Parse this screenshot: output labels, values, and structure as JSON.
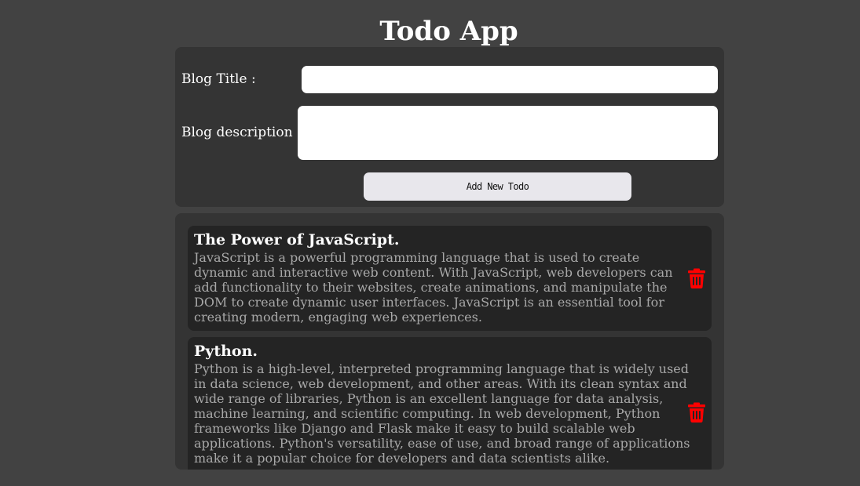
{
  "header": {
    "title": "Todo App"
  },
  "form": {
    "title_label": "Blog Title :",
    "title_value": "",
    "description_label": "Blog description :",
    "description_value": "",
    "add_button_label": "Add New Todo"
  },
  "todos": [
    {
      "title": "The Power of JavaScript.",
      "description": "JavaScript is a powerful programming language that is used to create dynamic and interactive web content. With JavaScript, web developers can add functionality to their websites, create animations, and manipulate the DOM to create dynamic user interfaces. JavaScript is an essential tool for creating modern, engaging web experiences.",
      "delete_icon": "trash-icon"
    },
    {
      "title": "Python.",
      "description": "Python is a high-level, interpreted programming language that is widely used in data science, web development, and other areas. With its clean syntax and wide range of libraries, Python is an excellent language for data analysis, machine learning, and scientific computing. In web development, Python frameworks like Django and Flask make it easy to build scalable web applications. Python's versatility, ease of use, and broad range of applications make it a popular choice for developers and data scientists alike.",
      "delete_icon": "trash-icon"
    }
  ],
  "colors": {
    "background": "#424242",
    "card": "#343434",
    "todo_card": "#242424",
    "delete": "#ff0000"
  }
}
